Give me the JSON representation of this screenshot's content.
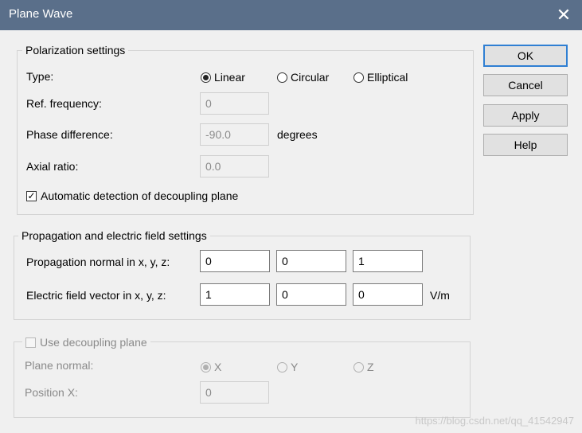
{
  "window": {
    "title": "Plane Wave",
    "close_glyph": "✕"
  },
  "polarization": {
    "legend": "Polarization settings",
    "type_label": "Type:",
    "radios": [
      "Linear",
      "Circular",
      "Elliptical"
    ],
    "selected": "Linear",
    "ref_freq_label": "Ref. frequency:",
    "ref_freq_value": "0",
    "phase_label": "Phase difference:",
    "phase_value": "-90.0",
    "phase_unit": "degrees",
    "axial_label": "Axial ratio:",
    "axial_value": "0.0",
    "auto_detect_label": "Automatic detection of decoupling plane",
    "auto_detect_checked": true
  },
  "propagation": {
    "legend": "Propagation and electric field settings",
    "normal_label": "Propagation normal in x, y, z:",
    "normal_values": [
      "0",
      "0",
      "1"
    ],
    "efield_label": "Electric field vector in x, y, z:",
    "efield_values": [
      "1",
      "0",
      "0"
    ],
    "efield_unit": "V/m"
  },
  "decoupling": {
    "legend": "Use decoupling plane",
    "checked": false,
    "plane_normal_label": "Plane normal:",
    "radios": [
      "X",
      "Y",
      "Z"
    ],
    "selected": "X",
    "position_label": "Position X:",
    "position_value": "0"
  },
  "buttons": {
    "ok": "OK",
    "cancel": "Cancel",
    "apply": "Apply",
    "help": "Help"
  },
  "watermark": "https://blog.csdn.net/qq_41542947"
}
